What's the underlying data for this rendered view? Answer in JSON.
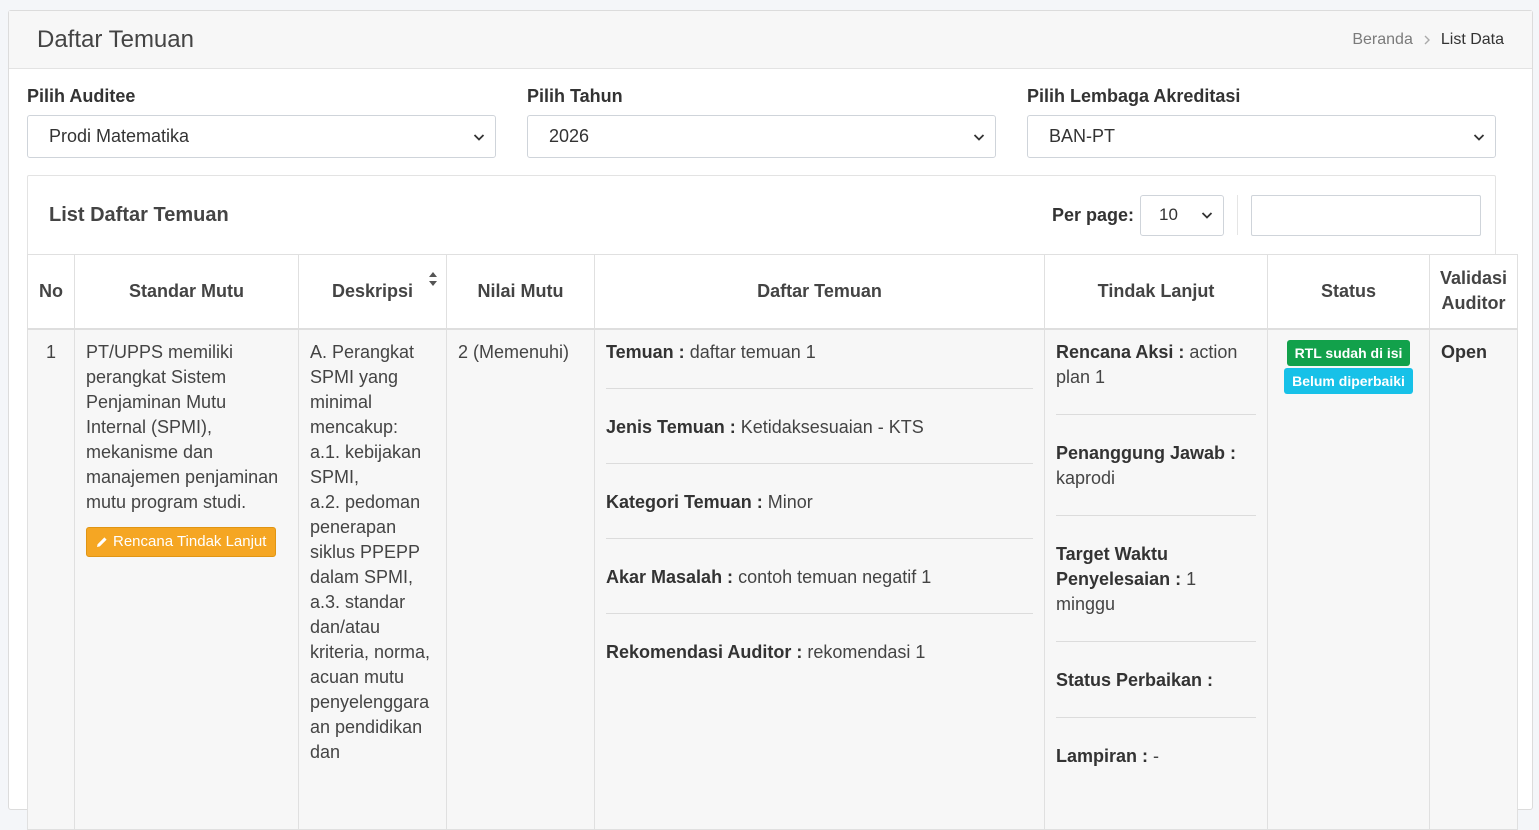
{
  "header": {
    "title": "Daftar Temuan",
    "breadcrumb": {
      "home": "Beranda",
      "current": "List Data"
    }
  },
  "filters": [
    {
      "label": "Pilih Auditee",
      "value": "Prodi Matematika"
    },
    {
      "label": "Pilih Tahun",
      "value": "2026"
    },
    {
      "label": "Pilih Lembaga Akreditasi",
      "value": "BAN-PT"
    }
  ],
  "list": {
    "title": "List Daftar Temuan",
    "per_page_label": "Per page:",
    "per_page_value": "10",
    "search_placeholder": ""
  },
  "table": {
    "columns": [
      "No",
      "Standar Mutu",
      "Deskripsi",
      "Nilai Mutu",
      "Daftar Temuan",
      "Tindak Lanjut",
      "Status",
      "Validasi Auditor"
    ],
    "rows": [
      {
        "no": "1",
        "standar_mutu": "PT/UPPS memiliki perangkat Sistem Penjaminan Mutu Internal (SPMI), mekanisme dan manajemen penjaminan mutu program studi.",
        "action_button": "Rencana Tindak Lanjut",
        "deskripsi": "A. Perangkat SPMI yang minimal mencakup:\na.1. kebijakan SPMI,\na.2. pedoman penerapan siklus PPEPP dalam SPMI,\na.3. standar dan/atau kriteria, norma, acuan mutu penyelenggara an pendidikan dan",
        "nilai_mutu": "2 (Memenuhi)",
        "daftar_temuan": [
          {
            "key": "Temuan :",
            "value": "daftar temuan 1"
          },
          {
            "key": "Jenis Temuan :",
            "value": "Ketidaksesuaian - KTS"
          },
          {
            "key": "Kategori Temuan :",
            "value": "Minor"
          },
          {
            "key": "Akar Masalah :",
            "value": "contoh temuan negatif 1"
          },
          {
            "key": "Rekomendasi Auditor :",
            "value": "rekomendasi 1"
          }
        ],
        "tindak_lanjut": [
          {
            "key": "Rencana Aksi :",
            "value": "action plan 1"
          },
          {
            "key": "Penanggung Jawab :",
            "value": "kaprodi"
          },
          {
            "key": "Target Waktu Penyelesaian :",
            "value": "1 minggu"
          },
          {
            "key": "Status Perbaikan :",
            "value": ""
          },
          {
            "key": "Lampiran :",
            "value": "-"
          }
        ],
        "status": [
          "RTL sudah di isi",
          "Belum diperbaiki"
        ],
        "validasi": "Open"
      }
    ]
  },
  "colors": {
    "badge_success": "#12a14b",
    "badge_info": "#17c1e8",
    "button_warning": "#f5a623"
  },
  "icons": [
    "chevron-down-icon",
    "chevron-right-icon",
    "sort-icon",
    "pencil-icon"
  ]
}
